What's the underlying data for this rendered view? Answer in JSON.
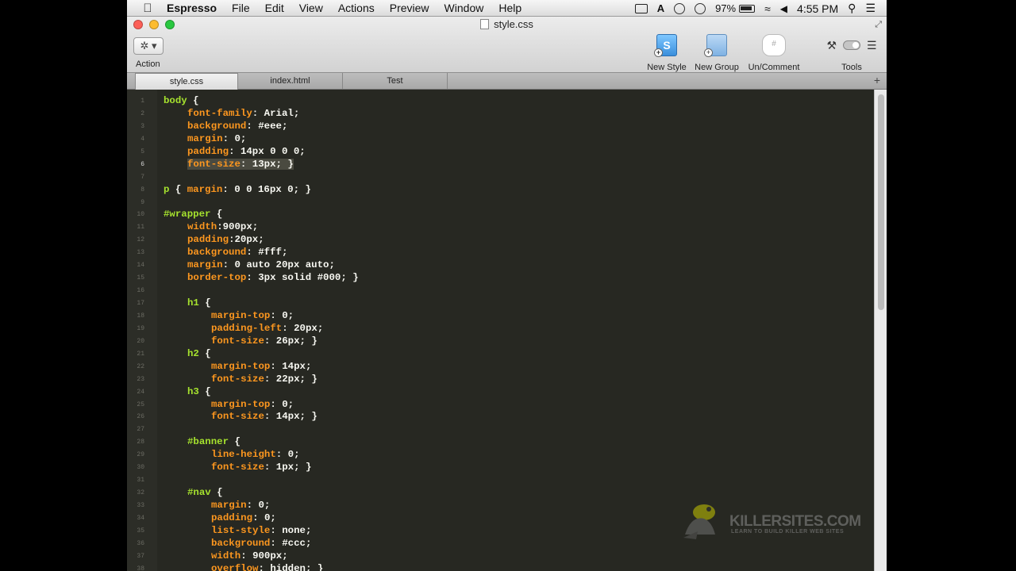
{
  "menubar": {
    "app_name": "Espresso",
    "items": [
      "File",
      "Edit",
      "View",
      "Actions",
      "Preview",
      "Window",
      "Help"
    ],
    "battery": "97%",
    "clock": "4:55 PM"
  },
  "window": {
    "title": "style.css"
  },
  "toolbar": {
    "action_label": "Action",
    "action_glyph": "✲ ▾",
    "new_style_label": "New Style",
    "new_group_label": "New Group",
    "uncomment_label": "Un/Comment",
    "tools_label": "Tools"
  },
  "tabs": [
    {
      "label": "style.css",
      "active": true
    },
    {
      "label": "index.html",
      "active": false
    },
    {
      "label": "Test",
      "active": false
    }
  ],
  "editor": {
    "current_line": 6,
    "lines": [
      {
        "n": "1",
        "d": 0,
        "parts": [
          [
            "sel",
            "body"
          ],
          [
            "punct",
            " {"
          ]
        ]
      },
      {
        "n": "2",
        "d": 1,
        "parts": [
          [
            "prop",
            "font-family"
          ],
          [
            "punct",
            ": "
          ],
          [
            "val",
            "Arial;"
          ]
        ]
      },
      {
        "n": "3",
        "d": 1,
        "parts": [
          [
            "prop",
            "background"
          ],
          [
            "punct",
            ": "
          ],
          [
            "val",
            "#eee;"
          ]
        ]
      },
      {
        "n": "4",
        "d": 1,
        "parts": [
          [
            "prop",
            "margin"
          ],
          [
            "punct",
            ": "
          ],
          [
            "val",
            "0;"
          ]
        ]
      },
      {
        "n": "5",
        "d": 1,
        "parts": [
          [
            "prop",
            "padding"
          ],
          [
            "punct",
            ": "
          ],
          [
            "val",
            "14px 0 0 0;"
          ]
        ]
      },
      {
        "n": "6",
        "d": 1,
        "hl": true,
        "parts": [
          [
            "prop",
            "font-size"
          ],
          [
            "punct",
            ": "
          ],
          [
            "val",
            "13px; }"
          ]
        ]
      },
      {
        "n": "7",
        "d": 0,
        "parts": []
      },
      {
        "n": "8",
        "d": 0,
        "parts": [
          [
            "sel",
            "p"
          ],
          [
            "punct",
            " { "
          ],
          [
            "prop",
            "margin"
          ],
          [
            "punct",
            ": "
          ],
          [
            "val",
            "0 0 16px 0; }"
          ]
        ]
      },
      {
        "n": "9",
        "d": 0,
        "parts": []
      },
      {
        "n": "10",
        "d": 0,
        "parts": [
          [
            "sel",
            "#wrapper"
          ],
          [
            "punct",
            " {"
          ]
        ]
      },
      {
        "n": "11",
        "d": 1,
        "parts": [
          [
            "prop",
            "width"
          ],
          [
            "punct",
            ":"
          ],
          [
            "val",
            "900px;"
          ]
        ]
      },
      {
        "n": "12",
        "d": 1,
        "parts": [
          [
            "prop",
            "padding"
          ],
          [
            "punct",
            ":"
          ],
          [
            "val",
            "20px;"
          ]
        ]
      },
      {
        "n": "13",
        "d": 1,
        "parts": [
          [
            "prop",
            "background"
          ],
          [
            "punct",
            ": "
          ],
          [
            "val",
            "#fff;"
          ]
        ]
      },
      {
        "n": "14",
        "d": 1,
        "parts": [
          [
            "prop",
            "margin"
          ],
          [
            "punct",
            ": "
          ],
          [
            "val",
            "0 auto 20px auto;"
          ]
        ]
      },
      {
        "n": "15",
        "d": 1,
        "parts": [
          [
            "prop",
            "border-top"
          ],
          [
            "punct",
            ": "
          ],
          [
            "val",
            "3px solid #000; }"
          ]
        ]
      },
      {
        "n": "16",
        "d": 0,
        "parts": []
      },
      {
        "n": "17",
        "d": 1,
        "parts": [
          [
            "sel",
            "h1"
          ],
          [
            "punct",
            " {"
          ]
        ]
      },
      {
        "n": "18",
        "d": 2,
        "parts": [
          [
            "prop",
            "margin-top"
          ],
          [
            "punct",
            ": "
          ],
          [
            "val",
            "0;"
          ]
        ]
      },
      {
        "n": "19",
        "d": 2,
        "parts": [
          [
            "prop",
            "padding-left"
          ],
          [
            "punct",
            ": "
          ],
          [
            "val",
            "20px;"
          ]
        ]
      },
      {
        "n": "20",
        "d": 2,
        "parts": [
          [
            "prop",
            "font-size"
          ],
          [
            "punct",
            ": "
          ],
          [
            "val",
            "26px; }"
          ]
        ]
      },
      {
        "n": "21",
        "d": 1,
        "parts": [
          [
            "sel",
            "h2"
          ],
          [
            "punct",
            " {"
          ]
        ]
      },
      {
        "n": "22",
        "d": 2,
        "parts": [
          [
            "prop",
            "margin-top"
          ],
          [
            "punct",
            ": "
          ],
          [
            "val",
            "14px;"
          ]
        ]
      },
      {
        "n": "23",
        "d": 2,
        "parts": [
          [
            "prop",
            "font-size"
          ],
          [
            "punct",
            ": "
          ],
          [
            "val",
            "22px; }"
          ]
        ]
      },
      {
        "n": "24",
        "d": 1,
        "parts": [
          [
            "sel",
            "h3"
          ],
          [
            "punct",
            " {"
          ]
        ]
      },
      {
        "n": "25",
        "d": 2,
        "parts": [
          [
            "prop",
            "margin-top"
          ],
          [
            "punct",
            ": "
          ],
          [
            "val",
            "0;"
          ]
        ]
      },
      {
        "n": "26",
        "d": 2,
        "parts": [
          [
            "prop",
            "font-size"
          ],
          [
            "punct",
            ": "
          ],
          [
            "val",
            "14px; }"
          ]
        ]
      },
      {
        "n": "27",
        "d": 0,
        "parts": []
      },
      {
        "n": "28",
        "d": 1,
        "parts": [
          [
            "sel",
            "#banner"
          ],
          [
            "punct",
            " {"
          ]
        ]
      },
      {
        "n": "29",
        "d": 2,
        "parts": [
          [
            "prop",
            "line-height"
          ],
          [
            "punct",
            ": "
          ],
          [
            "val",
            "0;"
          ]
        ]
      },
      {
        "n": "30",
        "d": 2,
        "parts": [
          [
            "prop",
            "font-size"
          ],
          [
            "punct",
            ": "
          ],
          [
            "val",
            "1px; }"
          ]
        ]
      },
      {
        "n": "31",
        "d": 0,
        "parts": []
      },
      {
        "n": "32",
        "d": 1,
        "parts": [
          [
            "sel",
            "#nav"
          ],
          [
            "punct",
            " {"
          ]
        ]
      },
      {
        "n": "33",
        "d": 2,
        "parts": [
          [
            "prop",
            "margin"
          ],
          [
            "punct",
            ": "
          ],
          [
            "val",
            "0;"
          ]
        ]
      },
      {
        "n": "34",
        "d": 2,
        "parts": [
          [
            "prop",
            "padding"
          ],
          [
            "punct",
            ": "
          ],
          [
            "val",
            "0;"
          ]
        ]
      },
      {
        "n": "35",
        "d": 2,
        "parts": [
          [
            "prop",
            "list-style"
          ],
          [
            "punct",
            ": "
          ],
          [
            "val",
            "none;"
          ]
        ]
      },
      {
        "n": "36",
        "d": 2,
        "parts": [
          [
            "prop",
            "background"
          ],
          [
            "punct",
            ": "
          ],
          [
            "val",
            "#ccc;"
          ]
        ]
      },
      {
        "n": "37",
        "d": 2,
        "parts": [
          [
            "prop",
            "width"
          ],
          [
            "punct",
            ": "
          ],
          [
            "val",
            "900px;"
          ]
        ]
      },
      {
        "n": "38",
        "d": 2,
        "parts": [
          [
            "prop",
            "overflow"
          ],
          [
            "punct",
            ": "
          ],
          [
            "val",
            "hidden; }"
          ]
        ]
      }
    ]
  },
  "watermark": {
    "brand": "KILLERSITES.COM",
    "tagline": "LEARN TO BUILD KILLER WEB SITES"
  },
  "colors": {
    "editor_bg": "#272822",
    "selector": "#a6e22e",
    "property": "#fd971f",
    "value": "#f8f8f2"
  }
}
